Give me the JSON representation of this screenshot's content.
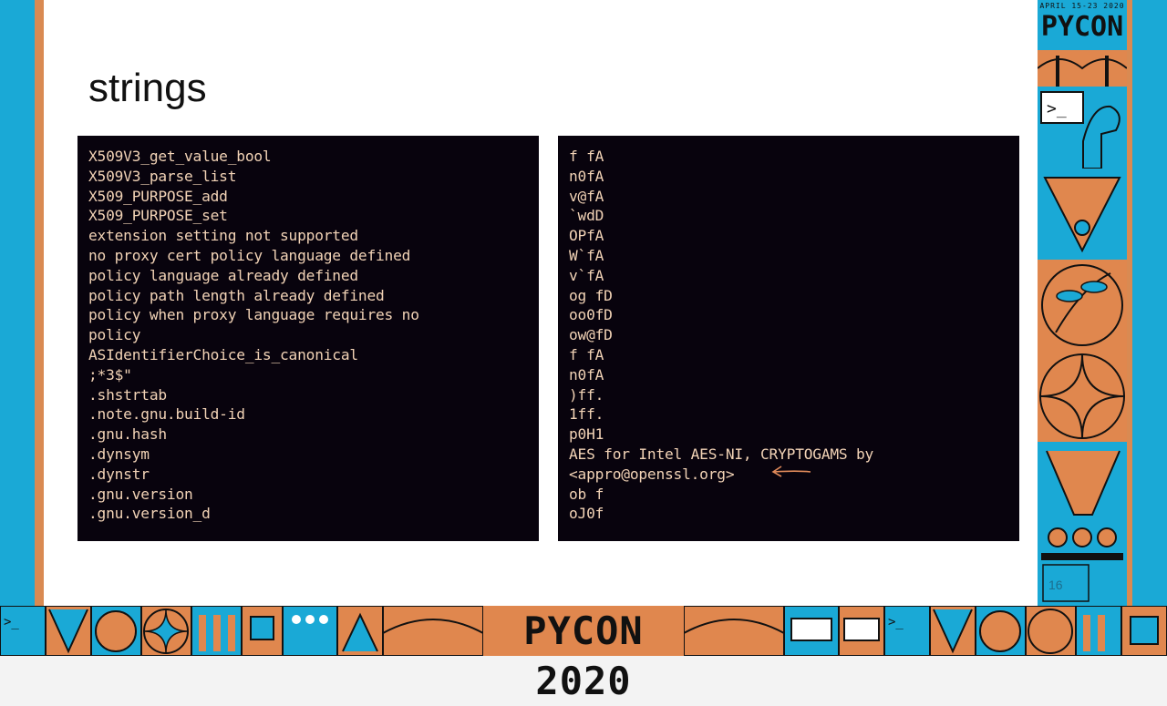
{
  "slide": {
    "title": "strings",
    "page_number": "16"
  },
  "left_panel": {
    "lines": [
      "X509V3_get_value_bool",
      "X509V3_parse_list",
      "X509_PURPOSE_add",
      "X509_PURPOSE_set",
      "extension setting not supported",
      "no proxy cert policy language defined",
      "policy language already defined",
      "policy path length already defined",
      "policy when proxy language requires no",
      "policy",
      "ASIdentifierChoice_is_canonical",
      ";*3$\"",
      ".shstrtab",
      ".note.gnu.build-id",
      ".gnu.hash",
      ".dynsym",
      ".dynstr",
      ".gnu.version",
      ".gnu.version_d"
    ]
  },
  "right_panel": {
    "lines": [
      "f fA",
      "n0fA",
      "v@fA",
      "`wdD",
      "OPfA",
      "W`fA",
      "v`fA",
      "og fD",
      "oo0fD",
      "ow@fD",
      "f fA",
      "n0fA",
      ")ff.",
      "1ff.",
      "p0H1",
      "AES for Intel AES-NI, CRYPTOGAMS by",
      "<appro@openssl.org>",
      "ob f",
      "oJ0f"
    ]
  },
  "branding": {
    "logo_text": "PYCON",
    "logo_date": "APRIL 15-23 2020",
    "banner_text": "PYCON 2020"
  },
  "colors": {
    "panel_bg": "#08030d",
    "code_text": "#f2d3b6",
    "frame_blue": "#1aa9d6",
    "frame_orange": "#e0874e",
    "arrow": "#e08a5a"
  }
}
